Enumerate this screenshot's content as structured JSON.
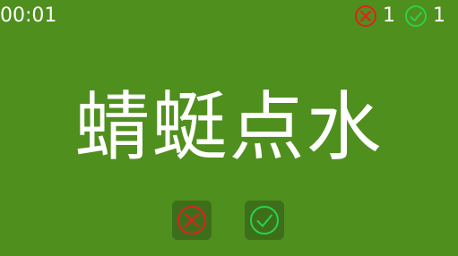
{
  "timer": {
    "text": "00:01"
  },
  "score": {
    "wrong": {
      "icon": "cross-circle-icon",
      "count": "1",
      "color": "#e02020"
    },
    "correct": {
      "icon": "check-circle-icon",
      "count": "1",
      "color": "#2bd14a"
    }
  },
  "word": {
    "text": "蜻蜓点水"
  },
  "buttons": {
    "wrong": {
      "icon": "cross-circle-icon",
      "color": "#e02020"
    },
    "correct": {
      "icon": "check-circle-icon",
      "color": "#2bd14a"
    }
  },
  "colors": {
    "background": "#4f8f1d",
    "button_background": "#3d6f1b",
    "text": "#ffffff"
  }
}
